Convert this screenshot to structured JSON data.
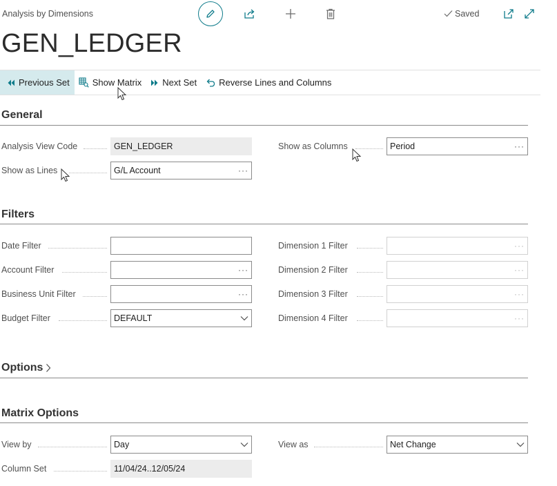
{
  "header": {
    "breadcrumb": "Analysis by Dimensions",
    "title": "GEN_LEDGER",
    "saved_label": "Saved"
  },
  "actions": [
    {
      "label": "Previous Set",
      "icon": "previous-set-icon"
    },
    {
      "label": "Show Matrix",
      "icon": "matrix-icon"
    },
    {
      "label": "Next Set",
      "icon": "next-set-icon"
    },
    {
      "label": "Reverse Lines and Columns",
      "icon": "undo-icon"
    }
  ],
  "general": {
    "title": "General",
    "analysis_view_code": {
      "label": "Analysis View Code",
      "value": "GEN_LEDGER"
    },
    "show_as_lines": {
      "label": "Show as Lines",
      "value": "G/L Account"
    },
    "show_as_columns": {
      "label": "Show as Columns",
      "value": "Period"
    }
  },
  "filters": {
    "title": "Filters",
    "date_filter": {
      "label": "Date Filter",
      "value": ""
    },
    "account_filter": {
      "label": "Account Filter",
      "value": ""
    },
    "business_unit_filter": {
      "label": "Business Unit Filter",
      "value": ""
    },
    "budget_filter": {
      "label": "Budget Filter",
      "value": "DEFAULT"
    },
    "dimension1": {
      "label": "Dimension 1 Filter",
      "value": ""
    },
    "dimension2": {
      "label": "Dimension 2 Filter",
      "value": ""
    },
    "dimension3": {
      "label": "Dimension 3 Filter",
      "value": ""
    },
    "dimension4": {
      "label": "Dimension 4 Filter",
      "value": ""
    }
  },
  "options": {
    "title": "Options"
  },
  "matrix_options": {
    "title": "Matrix Options",
    "view_by": {
      "label": "View by",
      "value": "Day"
    },
    "view_as": {
      "label": "View as",
      "value": "Net Change"
    },
    "column_set": {
      "label": "Column Set",
      "value": "11/04/24..12/05/24"
    }
  },
  "colors": {
    "accent": "#0e7b8a",
    "active_action_bg": "#d5eaed"
  }
}
